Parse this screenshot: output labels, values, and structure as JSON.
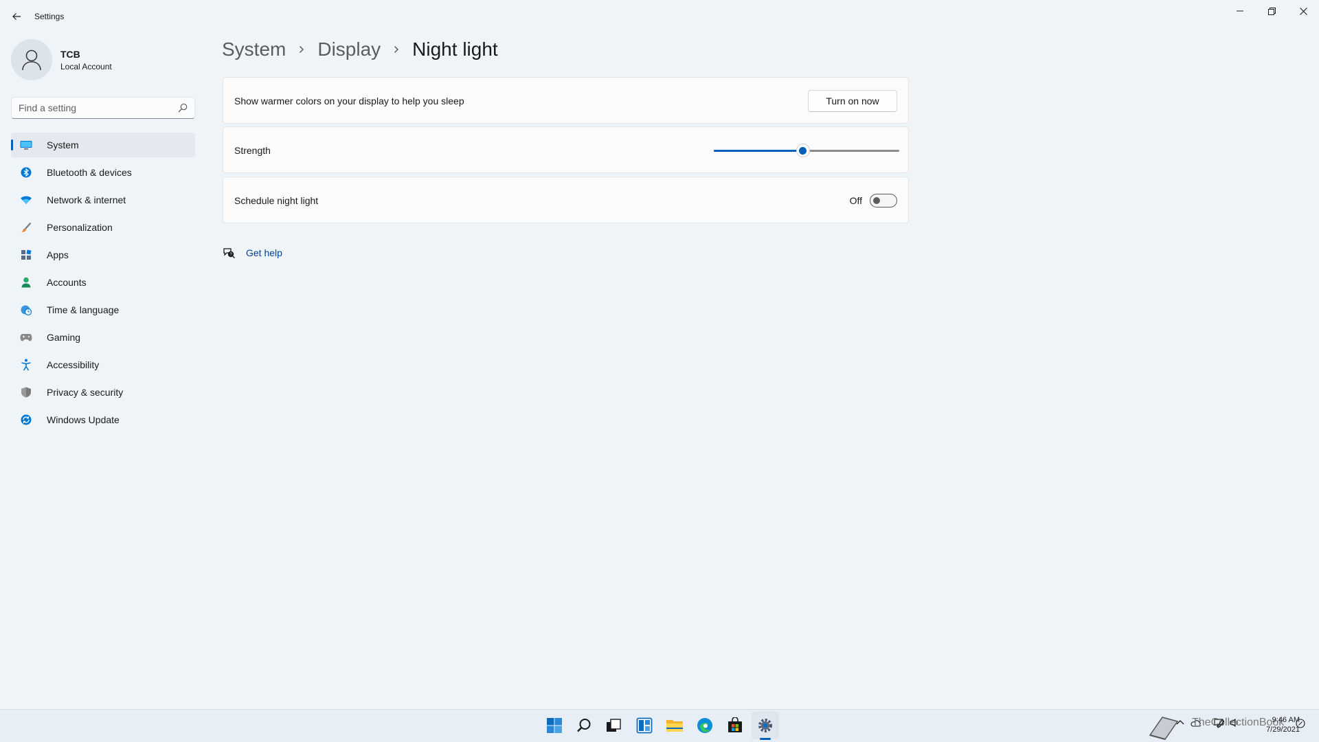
{
  "window": {
    "title": "Settings"
  },
  "profile": {
    "name": "TCB",
    "account_type": "Local Account"
  },
  "search": {
    "placeholder": "Find a setting",
    "value": ""
  },
  "sidebar": {
    "items": [
      {
        "label": "System",
        "icon": "monitor-icon",
        "active": true
      },
      {
        "label": "Bluetooth & devices",
        "icon": "bluetooth-icon",
        "active": false
      },
      {
        "label": "Network & internet",
        "icon": "wifi-icon",
        "active": false
      },
      {
        "label": "Personalization",
        "icon": "brush-icon",
        "active": false
      },
      {
        "label": "Apps",
        "icon": "apps-icon",
        "active": false
      },
      {
        "label": "Accounts",
        "icon": "person-icon",
        "active": false
      },
      {
        "label": "Time & language",
        "icon": "globe-clock-icon",
        "active": false
      },
      {
        "label": "Gaming",
        "icon": "controller-icon",
        "active": false
      },
      {
        "label": "Accessibility",
        "icon": "accessibility-icon",
        "active": false
      },
      {
        "label": "Privacy & security",
        "icon": "shield-icon",
        "active": false
      },
      {
        "label": "Windows Update",
        "icon": "update-icon",
        "active": false
      }
    ]
  },
  "breadcrumb": {
    "items": [
      "System",
      "Display"
    ],
    "current": "Night light"
  },
  "cards": {
    "turn_on": {
      "label": "Show warmer colors on your display to help you sleep",
      "button": "Turn on now"
    },
    "strength": {
      "label": "Strength",
      "value_fraction": 0.48
    },
    "schedule": {
      "label": "Schedule night light",
      "state": "Off",
      "on": false
    }
  },
  "help": {
    "label": "Get help"
  },
  "taskbar": {
    "apps": [
      "start-icon",
      "search-icon",
      "task-view-icon",
      "widgets-icon",
      "file-explorer-icon",
      "edge-icon",
      "store-icon",
      "settings-icon"
    ],
    "active_app": "settings-icon",
    "watermark": "TheCollectionBook",
    "clock": {
      "time": "9:46 AM",
      "date": "7/29/2021"
    }
  },
  "colors": {
    "accent": "#005fb8",
    "background": "#eff4f9",
    "card": "#fbfbfb"
  }
}
